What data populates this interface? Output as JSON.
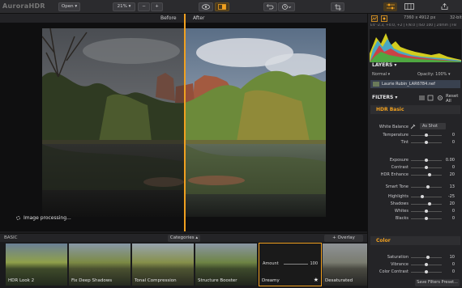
{
  "app": {
    "logo": "AuroraHDR"
  },
  "toolbar": {
    "open_label": "Open ▾",
    "zoom_label": "21% ▾",
    "zoom_out": "−",
    "zoom_in": "+",
    "accent": "#f0a020"
  },
  "compare": {
    "before_label": "Before",
    "after_label": "After"
  },
  "canvas": {
    "processing_text": "Image processing..."
  },
  "presets": {
    "section_label": "BASIC",
    "categories_label": "Categories ▴",
    "overlay_label": "+ Overlay Preset...",
    "items": [
      {
        "label": "HDR Look 2"
      },
      {
        "label": "Fix Deep Shadows"
      },
      {
        "label": "Tonal Compression"
      },
      {
        "label": "Structure Booster"
      },
      {
        "label": "Dreamy",
        "amount_label": "Amount",
        "amount_value": "100",
        "favorite": "★"
      },
      {
        "label": "Desaturated"
      }
    ]
  },
  "panel": {
    "dimensions": "7360 x 4912 px",
    "bit_depth": "32-bit",
    "exif": "EV -2.3, +0.0, +2 | F/8.0 | ISO 100 | 24mm | F8",
    "layers_title": "LAYERS ▾",
    "blend_mode": "Normal ▾",
    "opacity_label": "Opacity: 100% ▾",
    "layer_name": "Laurie Rubin_LAR6784.nef",
    "filters_title": "FILTERS ▾",
    "reset_label": "Reset All",
    "hdr_basic": {
      "title": "HDR Basic",
      "white_balance_label": "White Balance",
      "white_balance_value": "As Shot",
      "rows": [
        {
          "label": "Temperature",
          "value": "0",
          "pos": 0.5
        },
        {
          "label": "Tint",
          "value": "0",
          "pos": 0.5
        },
        {
          "label": "Exposure",
          "value": "0.00",
          "pos": 0.5
        },
        {
          "label": "Contrast",
          "value": "0",
          "pos": 0.5
        },
        {
          "label": "HDR Enhance",
          "value": "20",
          "pos": 0.6
        },
        {
          "label": "Smart Tone",
          "value": "13",
          "pos": 0.565
        },
        {
          "label": "Highlights",
          "value": "-25",
          "pos": 0.375
        },
        {
          "label": "Shadows",
          "value": "20",
          "pos": 0.6
        },
        {
          "label": "Whites",
          "value": "0",
          "pos": 0.5
        },
        {
          "label": "Blacks",
          "value": "0",
          "pos": 0.5
        }
      ]
    },
    "color": {
      "title": "Color",
      "rows": [
        {
          "label": "Saturation",
          "value": "10",
          "pos": 0.55
        },
        {
          "label": "Vibrance",
          "value": "0",
          "pos": 0.5
        },
        {
          "label": "Color Contrast",
          "value": "0",
          "pos": 0.5
        }
      ]
    },
    "save_filters_label": "Save Filters Preset..."
  }
}
